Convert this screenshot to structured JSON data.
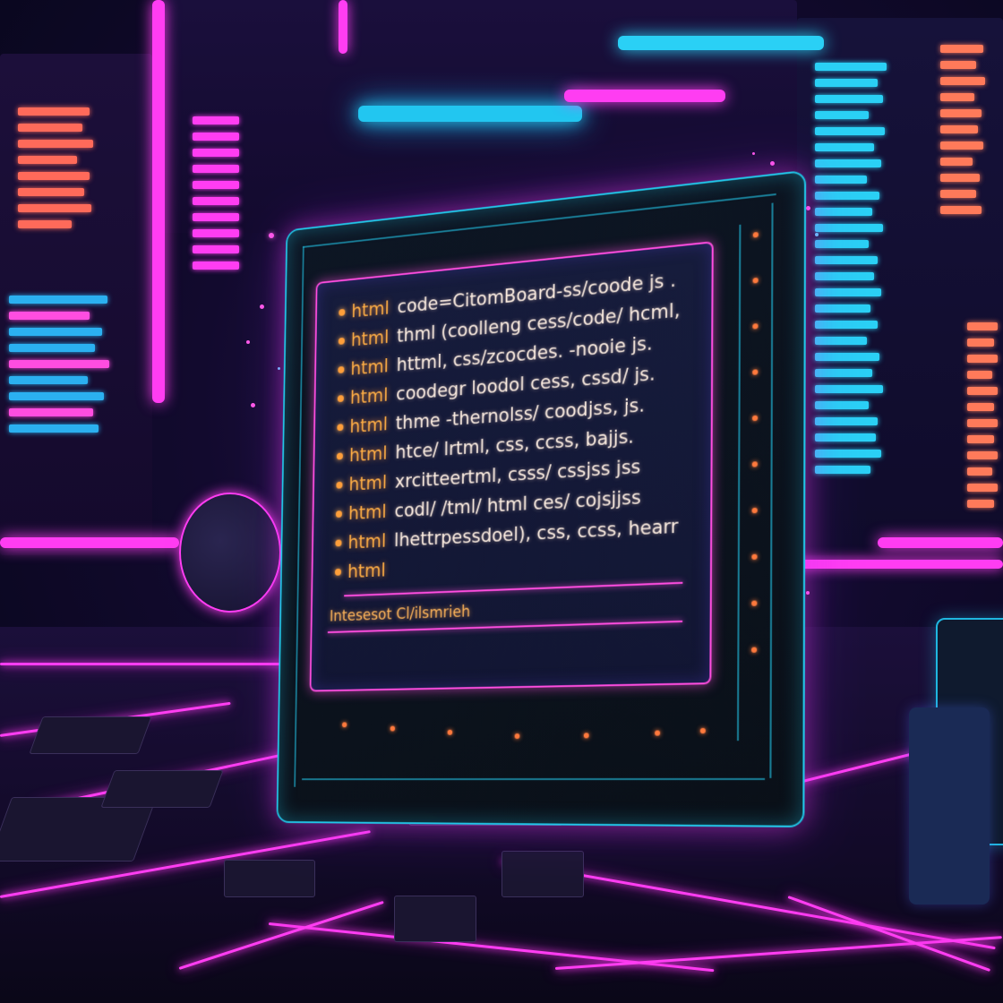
{
  "scene": {
    "accent_pink": "#ff3df2",
    "accent_cyan": "#22c6e8",
    "accent_orange": "#ff9f3a"
  },
  "screen": {
    "lines": [
      {
        "keyword": "html",
        "text": "code=CitomBoard-ss/coode js ."
      },
      {
        "keyword": "html",
        "text": "thml (coolleng cess/code/ hcml,"
      },
      {
        "keyword": "html",
        "text": "httml, css/zcocdes. -nooie js."
      },
      {
        "keyword": "html",
        "text": "coodegr loodol cess, cssd/ js."
      },
      {
        "keyword": "html",
        "text": "thme -thernolss/ coodjss, js."
      },
      {
        "keyword": "html",
        "text": "htce/ lrtml, css, ccss, bajjs."
      },
      {
        "keyword": "html",
        "text": "xrcitteertml, csss/ cssjss jss"
      },
      {
        "keyword": "html",
        "text": "codl/ /tml/ html  ces/ cojsjjss"
      },
      {
        "keyword": "html",
        "text": "lhettrpessdoel), css, ccss, hearr"
      },
      {
        "keyword": "html",
        "text": ""
      }
    ],
    "footer": "Intesesot Cl/ilsmrieh"
  }
}
